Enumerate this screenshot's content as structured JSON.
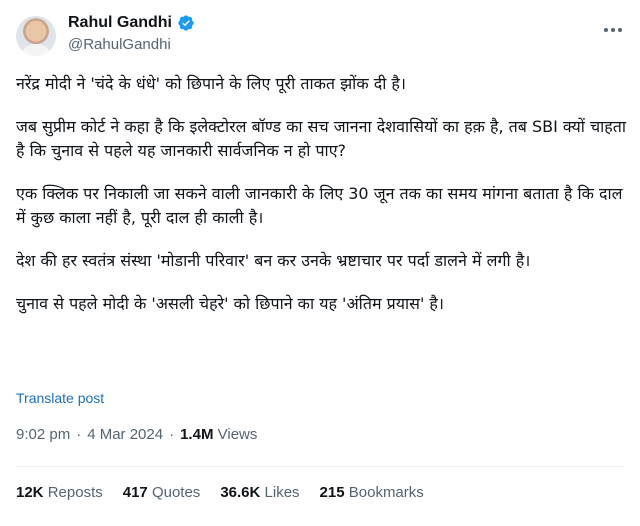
{
  "author": {
    "display_name": "Rahul Gandhi",
    "handle": "@RahulGandhi",
    "verified": true
  },
  "tweet": {
    "paragraphs": [
      "नरेंद्र मोदी ने 'चंदे के धंधे' को छिपाने के लिए पूरी ताकत झोंक दी है।",
      "जब सुप्रीम कोर्ट ने कहा है कि इलेक्टोरल बॉण्ड का सच जानना देशवासियों का हक़ है, तब SBI क्यों चाहता है कि चुनाव से पहले यह जानकारी सार्वजनिक न हो पाए?",
      "एक क्लिक पर निकाली जा सकने वाली जानकारी के लिए 30 जून तक का समय मांगना बताता है कि दाल में कुछ काला नहीं है, पूरी दाल ही काली है।",
      "देश की हर स्वतंत्र संस्था 'मोडानी परिवार' बन कर उनके भ्रष्टाचार पर पर्दा डालने में लगी है।",
      "चुनाव से पहले मोदी के 'असली चेहरे' को छिपाने का यह 'अंतिम प्रयास' है।"
    ],
    "translate_label": "Translate post",
    "time": "9:02 pm",
    "date": "4 Mar 2024",
    "separator": "·",
    "views_count": "1.4M",
    "views_label": "Views"
  },
  "stats": [
    {
      "count": "12K",
      "label": "Reposts"
    },
    {
      "count": "417",
      "label": "Quotes"
    },
    {
      "count": "36.6K",
      "label": "Likes"
    },
    {
      "count": "215",
      "label": "Bookmarks"
    }
  ],
  "colors": {
    "verified_badge": "#1d9bf0",
    "link": "#1d6fb5",
    "muted_text": "#536471",
    "primary_text": "#0f1419"
  },
  "icons": [
    "verified-badge-icon",
    "more-options-icon"
  ]
}
